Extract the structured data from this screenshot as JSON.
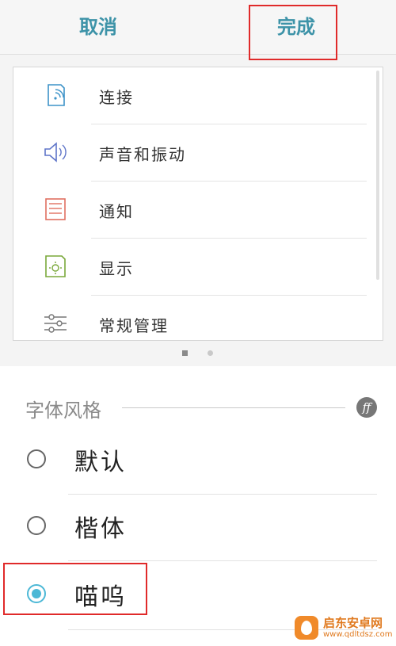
{
  "header": {
    "cancel_label": "取消",
    "done_label": "完成"
  },
  "preview": {
    "items": [
      {
        "label": "连接",
        "icon": "connection-icon"
      },
      {
        "label": "声音和振动",
        "icon": "speaker-icon"
      },
      {
        "label": "通知",
        "icon": "notification-icon"
      },
      {
        "label": "显示",
        "icon": "display-icon"
      },
      {
        "label": "常规管理",
        "icon": "sliders-icon"
      }
    ]
  },
  "font_style": {
    "title": "字体风格",
    "options": [
      {
        "label": "默认",
        "selected": false
      },
      {
        "label": "楷体",
        "selected": false
      },
      {
        "label": "喵呜",
        "selected": true
      }
    ]
  },
  "watermark": {
    "title": "启东安卓网",
    "url": "www.qdltdsz.com"
  },
  "colors": {
    "accent": "#3d93a8",
    "radio_selected": "#4cb8d6",
    "highlight": "#e02a2a"
  }
}
